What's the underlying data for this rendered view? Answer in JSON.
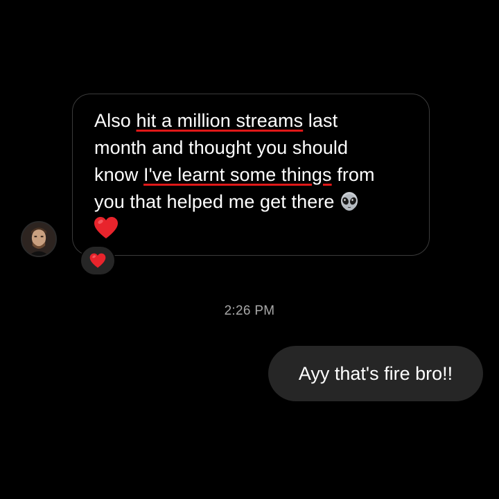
{
  "conversation": {
    "incoming": {
      "lines": [
        {
          "before": "Also ",
          "highlight": "hit a million streams",
          "after": " last"
        },
        {
          "text": "month and thought you should"
        },
        {
          "before": "know ",
          "highlight": "I've learnt some things",
          "after": " from"
        },
        {
          "text": "you that helped me get there"
        }
      ],
      "trailing_icon": "alien-emoji-icon",
      "second_line_icon": "red-heart-emoji-icon",
      "reaction": "red-heart-emoji-icon",
      "sender_avatar": "avatar"
    },
    "timestamp": "2:26 PM",
    "outgoing": {
      "text": "Ayy that's fire bro!!"
    }
  },
  "colors": {
    "background": "#000000",
    "incoming_border": "#3b3b3b",
    "outgoing_bubble": "#262626",
    "underline": "#e01818",
    "timestamp": "#a8a8a8",
    "heart": "#e8242c"
  }
}
